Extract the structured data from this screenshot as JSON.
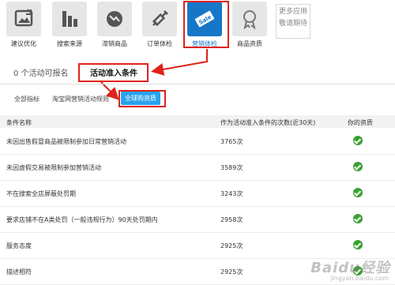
{
  "toolbar": {
    "items": [
      {
        "label": "建议优化",
        "icon": "image-up-icon"
      },
      {
        "label": "搜索来源",
        "icon": "bar-chart-icon"
      },
      {
        "label": "滞销商品",
        "icon": "trend-down-icon"
      },
      {
        "label": "订单体检",
        "icon": "syringe-icon"
      },
      {
        "label": "营销体检",
        "icon": "sale-tag-icon",
        "badge": "Sale"
      },
      {
        "label": "商品资质",
        "icon": "award-ribbon-icon"
      }
    ],
    "more": "更多应用 敬请期待"
  },
  "tabs": {
    "count": "0 个活动可报名",
    "conditions": "活动准入条件"
  },
  "subtabs": {
    "all": "全部指标",
    "taobao": "淘宝网营销活动规则",
    "global": "全球购资质"
  },
  "table": {
    "headers": [
      "条件名称",
      "作为活动准入条件的次数(近30天)",
      "你的资质"
    ],
    "rows": [
      {
        "name": "未因出售假冒商品被限制参加日常营销活动",
        "count": "3765次"
      },
      {
        "name": "未因虚假交易被限制参加营销活动",
        "count": "3589次"
      },
      {
        "name": "不在搜索全店屏蔽处罚期",
        "count": "3243次"
      },
      {
        "name": "要求店铺不在A类处罚（一般违规行为）90天处罚期内",
        "count": "2958次"
      },
      {
        "name": "服务态度",
        "count": "2925次"
      },
      {
        "name": "描述相符",
        "count": "2925次"
      }
    ]
  },
  "watermark": "Baidu经验",
  "watermark_sub": "jingyan.baidu.com",
  "colors": {
    "accent": "#1677c9",
    "highlight": "#e0221c",
    "check": "#3aa132",
    "subtab_active": "#27a3ee"
  }
}
